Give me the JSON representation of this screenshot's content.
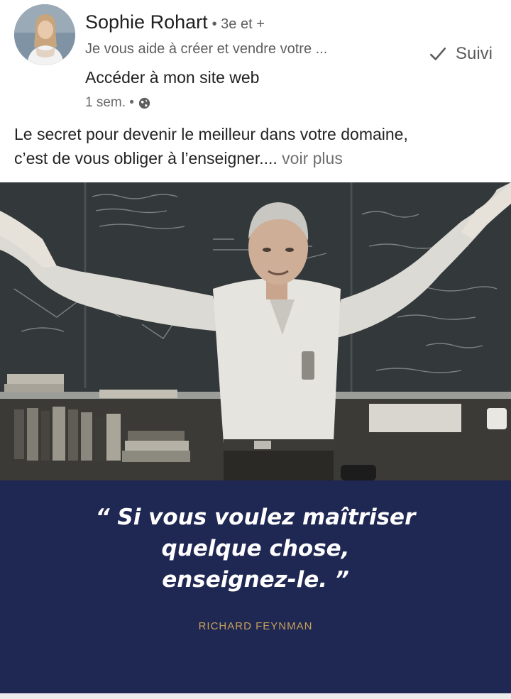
{
  "post": {
    "author_name": "Sophie Rohart",
    "degree": "• 3e et +",
    "tagline": "Je vous aide à créer et vendre votre ...",
    "follow_label": "Suivi",
    "site_link": "Accéder à mon site web",
    "timestamp": "1 sem. •",
    "text_line1": "Le secret pour devenir le meilleur dans votre domaine,",
    "text_line2": "c’est de vous obliger à l’enseigner....",
    "see_more": "voir plus"
  },
  "image": {
    "quote_line1": "“ Si vous voulez maîtriser",
    "quote_line2": "quelque chose,",
    "quote_line3": "enseignez-le. ”",
    "author": "RICHARD FEYNMAN",
    "colors": {
      "quote_bg": "#1f2753",
      "author_text": "#c7a15a"
    }
  },
  "icons": {
    "follow": "check-icon",
    "visibility": "globe-icon"
  }
}
